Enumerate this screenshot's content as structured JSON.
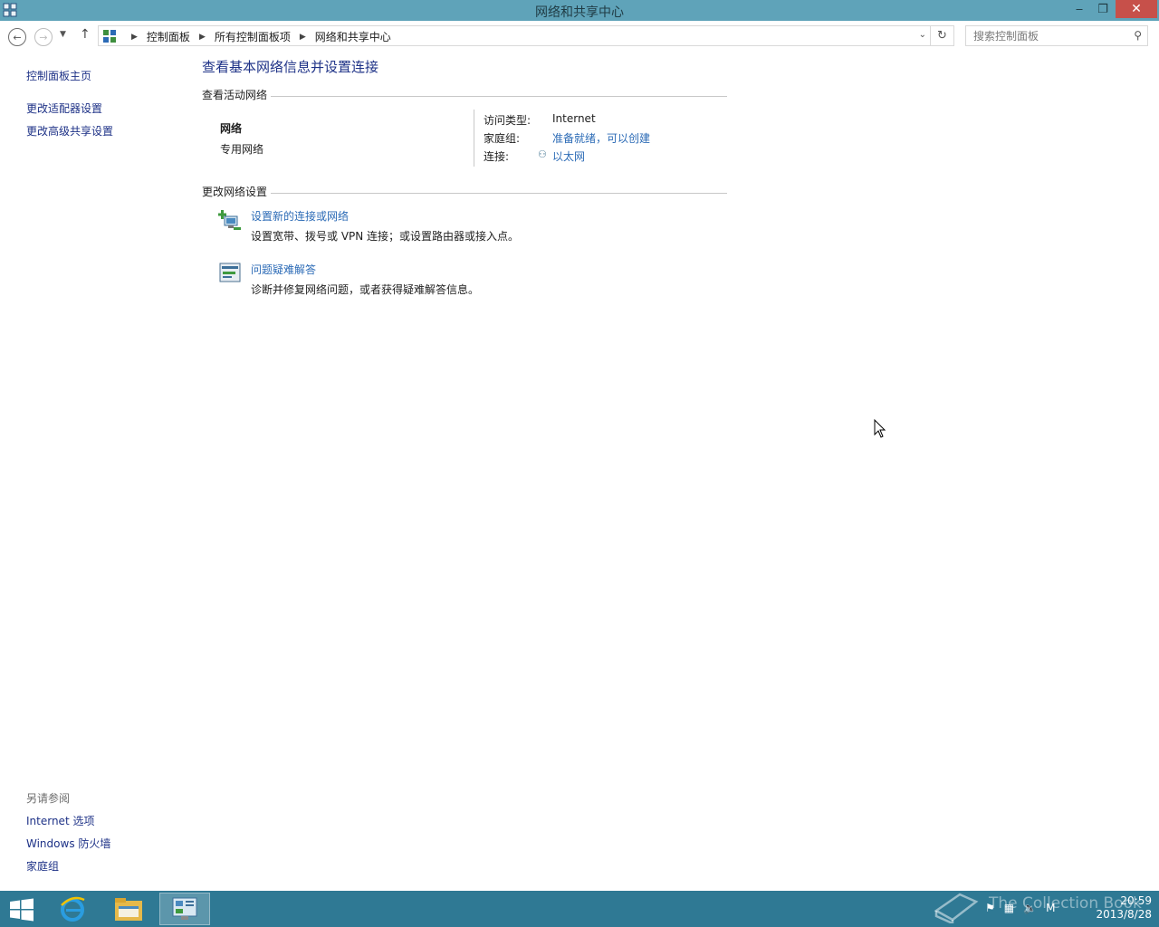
{
  "window": {
    "title": "网络和共享中心",
    "minimize": "‒",
    "maximize": "❐",
    "close": "✕"
  },
  "address_bar": {
    "crumbs": [
      "控制面板",
      "所有控制面板项",
      "网络和共享中心"
    ],
    "search_placeholder": "搜索控制面板"
  },
  "left_nav": {
    "items": [
      "控制面板主页",
      "更改适配器设置",
      "更改高级共享设置"
    ],
    "see_also_title": "另请参阅",
    "see_also": [
      "Internet 选项",
      "Windows 防火墙",
      "家庭组"
    ]
  },
  "main": {
    "title": "查看基本网络信息并设置连接",
    "active_networks_heading": "查看活动网络",
    "network": {
      "name": "网络",
      "category": "专用网络",
      "access_type_label": "访问类型:",
      "access_type_value": "Internet",
      "homegroup_label": "家庭组:",
      "homegroup_value": "准备就绪，可以创建",
      "connections_label": "连接:",
      "connections_value": "以太网"
    },
    "change_settings_heading": "更改网络设置",
    "tasks": [
      {
        "link": "设置新的连接或网络",
        "desc": "设置宽带、拨号或 VPN 连接；或设置路由器或接入点。",
        "icon": "new-connection-icon"
      },
      {
        "link": "问题疑难解答",
        "desc": "诊断并修复网络问题，或者获得疑难解答信息。",
        "icon": "troubleshoot-icon"
      }
    ]
  },
  "taskbar": {
    "apps": [
      "start-icon",
      "ie-icon",
      "file-explorer-icon",
      "control-panel-icon"
    ],
    "time": "20:59",
    "date": "2013/8/28",
    "watermark": "The Collection Book"
  },
  "colors": {
    "titlebar": "#5fa3b9",
    "taskbar": "#2f7994",
    "link": "#2c6bb6",
    "nav_link": "#1e3287",
    "close_button": "#c7504a"
  }
}
